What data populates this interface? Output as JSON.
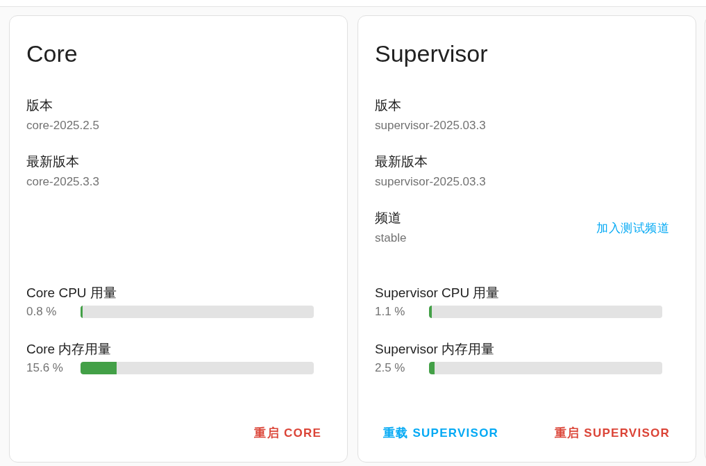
{
  "cards": [
    {
      "title": "Core",
      "info": [
        {
          "label": "版本",
          "value": "core-2025.2.5"
        },
        {
          "label": "最新版本",
          "value": "core-2025.3.3"
        }
      ],
      "metrics": [
        {
          "label": "Core CPU 用量",
          "reading": "0.8 %",
          "level": 0.008
        },
        {
          "label": "Core 内存用量",
          "reading": "15.6 %",
          "level": 0.156
        }
      ],
      "actions": [
        {
          "label": "重启 CORE",
          "kind": "danger"
        }
      ]
    },
    {
      "title": "Supervisor",
      "info": [
        {
          "label": "版本",
          "value": "supervisor-2025.03.3"
        },
        {
          "label": "最新版本",
          "value": "supervisor-2025.03.3"
        },
        {
          "label": "频道",
          "value": "stable",
          "action": "加入测试频道"
        }
      ],
      "metrics": [
        {
          "label": "Supervisor CPU 用量",
          "reading": "1.1 %",
          "level": 0.011
        },
        {
          "label": "Supervisor 内存用量",
          "reading": "2.5 %",
          "level": 0.025
        }
      ],
      "actions": [
        {
          "label": "重载 SUPERVISOR",
          "kind": "primary"
        },
        {
          "label": "重启 SUPERVISOR",
          "kind": "danger"
        }
      ]
    }
  ]
}
